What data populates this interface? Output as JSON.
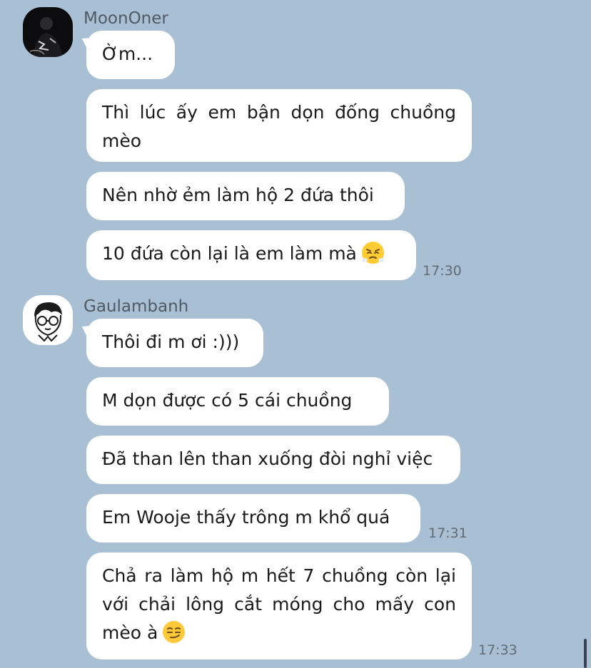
{
  "chat": {
    "groups": [
      {
        "sender": "MoonOner",
        "avatar_icon": "person-dark-avatar-icon",
        "messages": [
          {
            "text": "Ờm..."
          },
          {
            "text": "Thì lúc ấy em bận dọn đống chuồng mèo"
          },
          {
            "text": "Nên nhờ ẻm làm hộ 2 đứa thôi"
          },
          {
            "text": "10 đứa còn lại là em làm mà",
            "emoji": "fuming-face-emoji",
            "time": "17:30"
          }
        ]
      },
      {
        "sender": "Gaulambanh",
        "avatar_icon": "cartoon-glasses-avatar-icon",
        "messages": [
          {
            "text": "Thôi đi m ơi :)))"
          },
          {
            "text": "M dọn được có 5 cái chuồng"
          },
          {
            "text": "Đã than lên than xuống đòi nghỉ việc"
          },
          {
            "text": "Em Wooje thấy trông m khổ quá",
            "time": "17:31"
          },
          {
            "text": "Chả ra làm hộ m hết 7 chuồng còn lại với chải lông cắt móng cho mấy con mèo à",
            "emoji": "smirking-face-emoji",
            "time": "17:33"
          }
        ]
      }
    ]
  },
  "colors": {
    "background": "#a9c0d4",
    "bubble": "#ffffff",
    "sender_text": "#4f5a66",
    "time_text": "#5f6b77"
  }
}
